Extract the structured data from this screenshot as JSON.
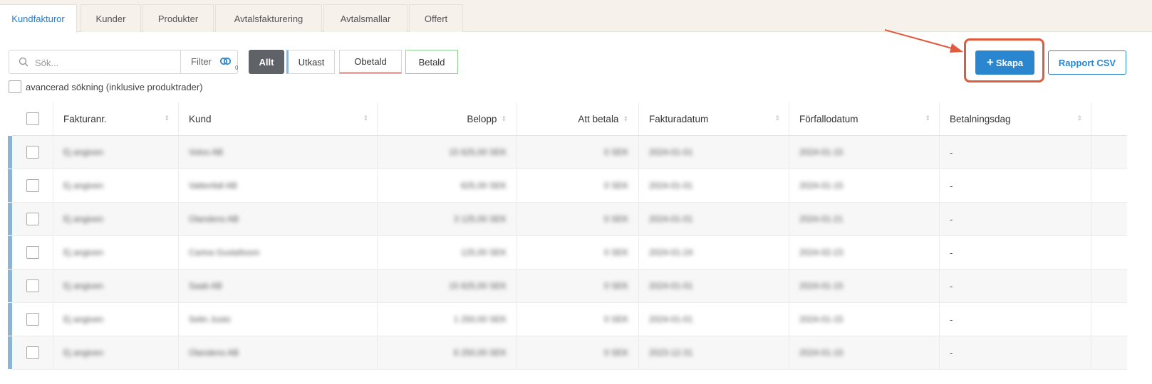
{
  "tabs": [
    "Kundfakturor",
    "Kunder",
    "Produkter",
    "Avtalsfakturering",
    "Avtalsmallar",
    "Offert"
  ],
  "search": {
    "placeholder": "Sök...",
    "filter_label": "Filter",
    "filter_count": "0"
  },
  "status_filters": [
    "Allt",
    "Utkast",
    "Obetald",
    "Betald"
  ],
  "advanced_search_label": "avancerad sökning (inklusive produktrader)",
  "actions": {
    "create_label": "Skapa",
    "csv_label": "Rapport CSV"
  },
  "columns": [
    "Fakturanr.",
    "Kund",
    "Belopp",
    "Att betala",
    "Fakturadatum",
    "Förfallodatum",
    "Betalningsdag"
  ],
  "rows": [
    {
      "nr": "Ej angiven",
      "kund": "Volvo AB",
      "belopp": "15 625,00 SEK",
      "att_betala": "0 SEK",
      "fdatum": "2024-01-01",
      "forfall": "2024-01-15",
      "betaldag": "-"
    },
    {
      "nr": "Ej angiven",
      "kund": "Vattenfall AB",
      "belopp": "625,00 SEK",
      "att_betala": "0 SEK",
      "fdatum": "2024-01-01",
      "forfall": "2024-01-15",
      "betaldag": "-"
    },
    {
      "nr": "Ej angiven",
      "kund": "Olandens AB",
      "belopp": "3 125,00 SEK",
      "att_betala": "0 SEK",
      "fdatum": "2024-01-01",
      "forfall": "2024-01-21",
      "betaldag": "-"
    },
    {
      "nr": "Ej angiven",
      "kund": "Carina Gustafsson",
      "belopp": "125,00 SEK",
      "att_betala": "0 SEK",
      "fdatum": "2024-01-24",
      "forfall": "2024-02-23",
      "betaldag": "-"
    },
    {
      "nr": "Ej angiven",
      "kund": "Saab AB",
      "belopp": "15 625,00 SEK",
      "att_betala": "0 SEK",
      "fdatum": "2024-01-01",
      "forfall": "2024-01-15",
      "betaldag": "-"
    },
    {
      "nr": "Ej angiven",
      "kund": "Selin Justo",
      "belopp": "1 250,00 SEK",
      "att_betala": "0 SEK",
      "fdatum": "2024-01-01",
      "forfall": "2024-01-15",
      "betaldag": "-"
    },
    {
      "nr": "Ej angiven",
      "kund": "Olandens AB",
      "belopp": "6 250,00 SEK",
      "att_betala": "0 SEK",
      "fdatum": "2023-12-31",
      "forfall": "2024-01-15",
      "betaldag": "-"
    }
  ],
  "colors": {
    "accent": "#2a86cf",
    "annotation": "#e05a3e",
    "draft_bar": "#8cb4d8",
    "paid": "#8fd18f",
    "unpaid": "#f4a3a3"
  }
}
